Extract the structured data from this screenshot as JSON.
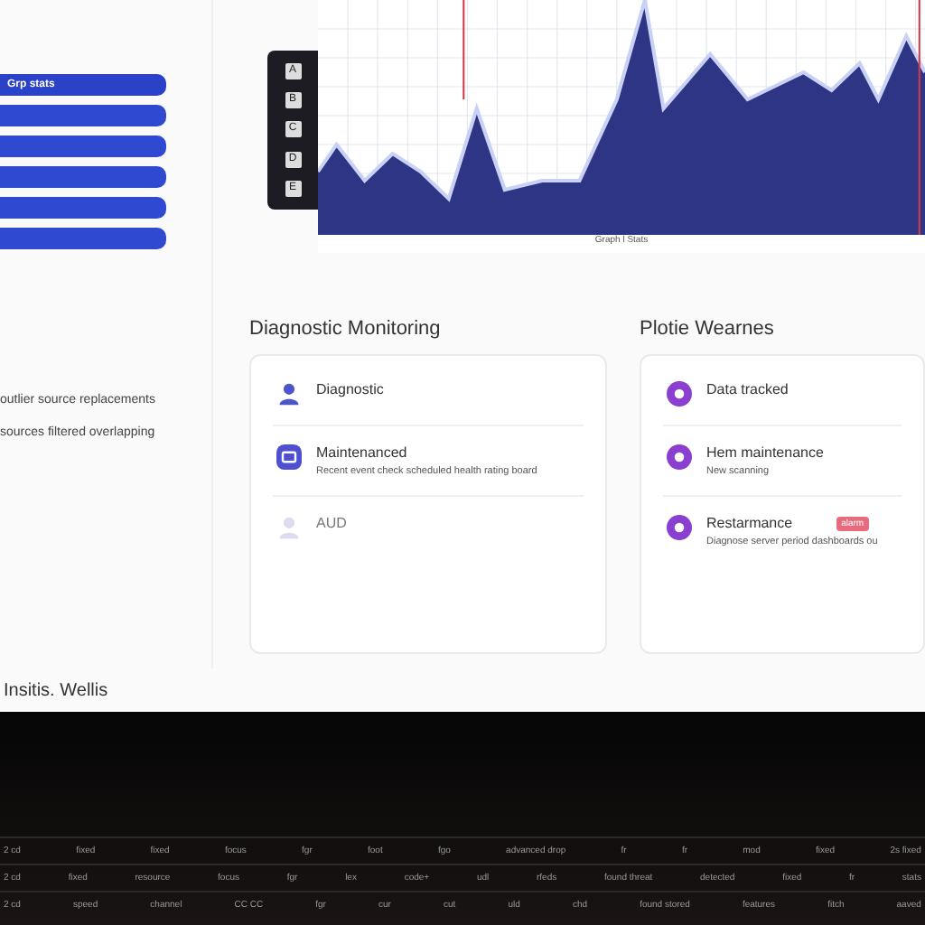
{
  "sidebar": {
    "items": [
      {
        "kind": "labeled",
        "label": "Grp stats"
      },
      {
        "kind": "blank"
      },
      {
        "kind": "blank"
      },
      {
        "kind": "blank"
      },
      {
        "kind": "blank"
      },
      {
        "kind": "blank"
      }
    ],
    "notes": [
      "outlier source replacements",
      "sources filtered overlapping"
    ]
  },
  "toolbar": {
    "tools": [
      "A",
      "B",
      "C",
      "D",
      "E"
    ]
  },
  "chart": {
    "caption": "Graph l Stats"
  },
  "diagnostics": {
    "title": "Diagnostic Monitoring",
    "items": [
      {
        "kind": "plain",
        "title": "Diagnostic",
        "enabled": true
      },
      {
        "kind": "detail",
        "title": "Maintenanced",
        "subtitle": "Recent event check scheduled health rating board",
        "enabled": true
      },
      {
        "kind": "plain",
        "title": "AUD",
        "enabled": false
      }
    ]
  },
  "profile": {
    "title": "Plotie Wearnes",
    "items": [
      {
        "title": "Data tracked"
      },
      {
        "title": "Hem maintenance",
        "subtitle": "New scanning"
      },
      {
        "title": "Restarmance",
        "subtitle": "Diagnose server period dashboards ou",
        "badge": "alarm"
      }
    ]
  },
  "footer_title": "Insitis. Wellis",
  "table": {
    "rows": [
      [
        "2 cd",
        "fixed",
        "fixed",
        "focus",
        "fgr",
        "foot",
        "fgo",
        "advanced drop",
        "fr",
        "fr",
        "mod",
        "fixed",
        "2s fixed"
      ],
      [
        "2 cd",
        "fixed",
        "resource",
        "focus",
        "fgr",
        "lex",
        "code+",
        "udl",
        "rfeds",
        "found threat",
        "detected",
        "fixed",
        "fr",
        "stats"
      ],
      [
        "2 cd",
        "speed",
        "channel",
        "CC CC",
        "fgr",
        "cur",
        "cut",
        "uld",
        "chd",
        "found stored",
        "features",
        "fitch",
        "aaved"
      ]
    ]
  }
}
